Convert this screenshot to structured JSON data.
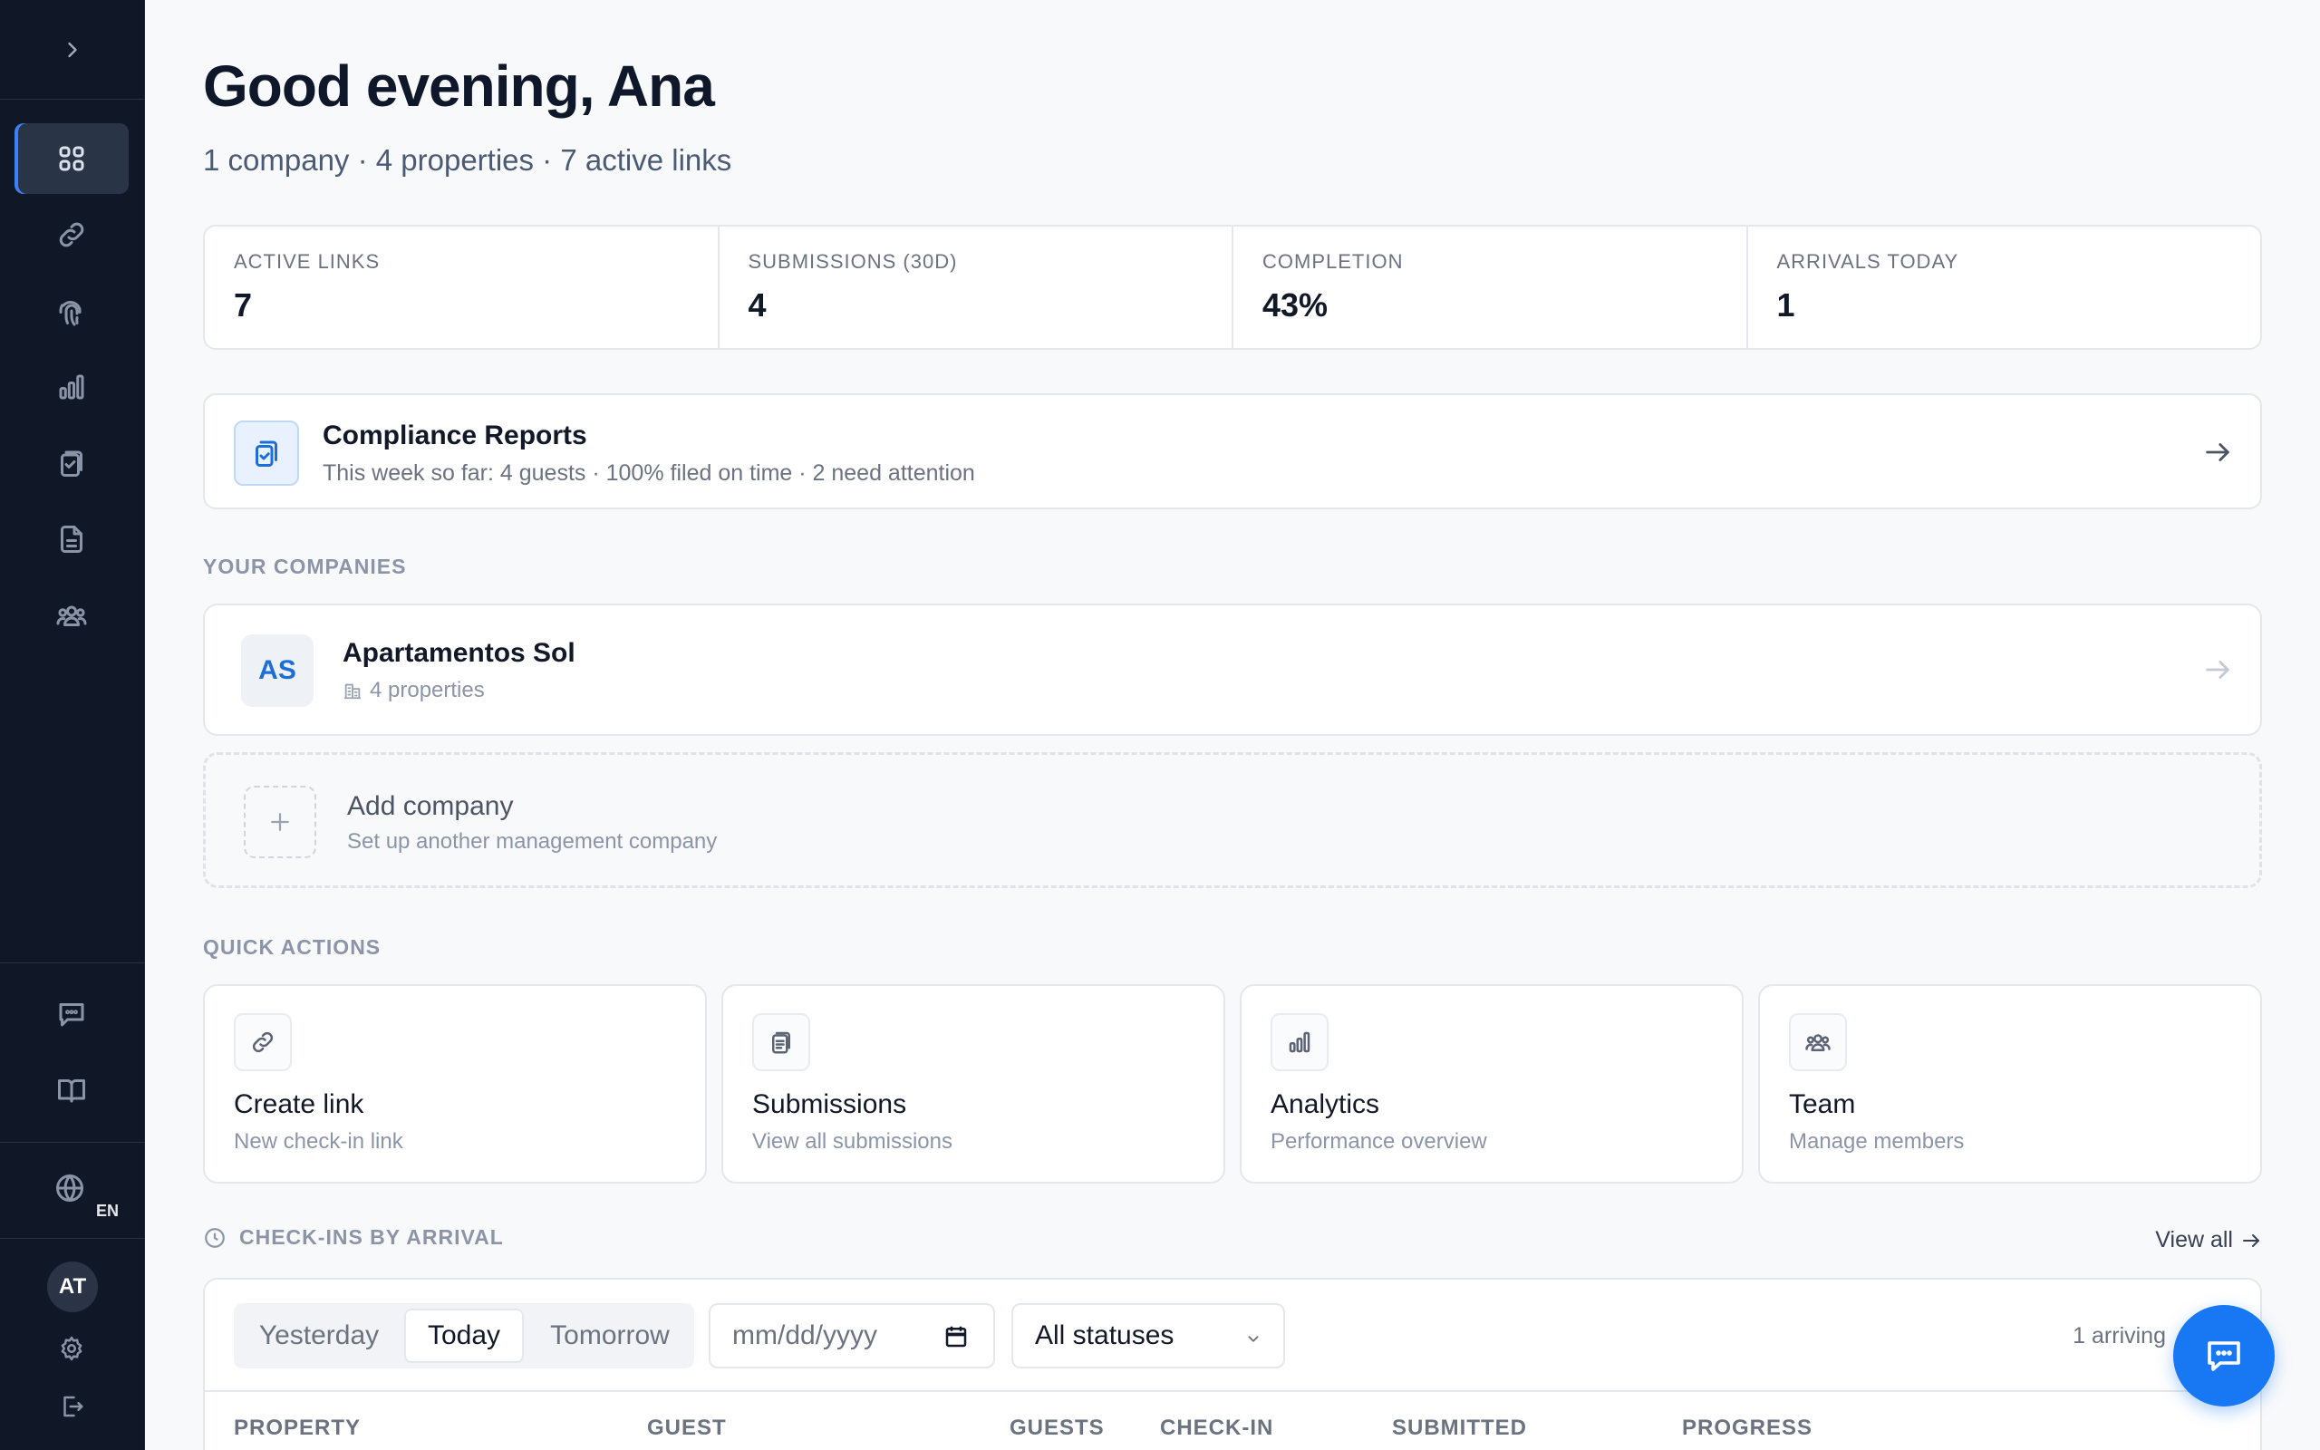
{
  "sidebar": {
    "language": "EN",
    "user_initials": "AT"
  },
  "header": {
    "greeting": "Good evening, Ana",
    "summary": "1 company · 4 properties · 7 active links"
  },
  "stats": [
    {
      "label": "ACTIVE LINKS",
      "value": "7"
    },
    {
      "label": "SUBMISSIONS (30D)",
      "value": "4"
    },
    {
      "label": "COMPLETION",
      "value": "43%"
    },
    {
      "label": "ARRIVALS TODAY",
      "value": "1"
    }
  ],
  "compliance": {
    "title": "Compliance Reports",
    "subtitle": "This week so far: 4 guests · 100% filed on time · 2 need attention"
  },
  "companies": {
    "section_title": "YOUR COMPANIES",
    "items": [
      {
        "initials": "AS",
        "name": "Apartamentos Sol",
        "properties": "4 properties"
      }
    ],
    "add_title": "Add company",
    "add_subtitle": "Set up another management company"
  },
  "quick_actions": {
    "section_title": "QUICK ACTIONS",
    "items": [
      {
        "title": "Create link",
        "subtitle": "New check-in link",
        "icon": "link-icon"
      },
      {
        "title": "Submissions",
        "subtitle": "View all submissions",
        "icon": "clipboard-icon"
      },
      {
        "title": "Analytics",
        "subtitle": "Performance overview",
        "icon": "bar-chart-icon"
      },
      {
        "title": "Team",
        "subtitle": "Manage members",
        "icon": "users-icon"
      }
    ]
  },
  "checkins": {
    "section_title": "CHECK-INS BY ARRIVAL",
    "view_all": "View all",
    "tabs": [
      "Yesterday",
      "Today",
      "Tomorrow"
    ],
    "active_tab": "Today",
    "date_placeholder": "mm/dd/yyyy",
    "status_filter": "All statuses",
    "arriving_count": "1 arriving",
    "columns": [
      "PROPERTY",
      "GUEST",
      "GUESTS",
      "CHECK-IN",
      "SUBMITTED",
      "PROGRESS"
    ]
  },
  "colors": {
    "sidebar_bg": "#101828",
    "accent": "#1877f2",
    "page_bg": "#f8f9fb"
  }
}
